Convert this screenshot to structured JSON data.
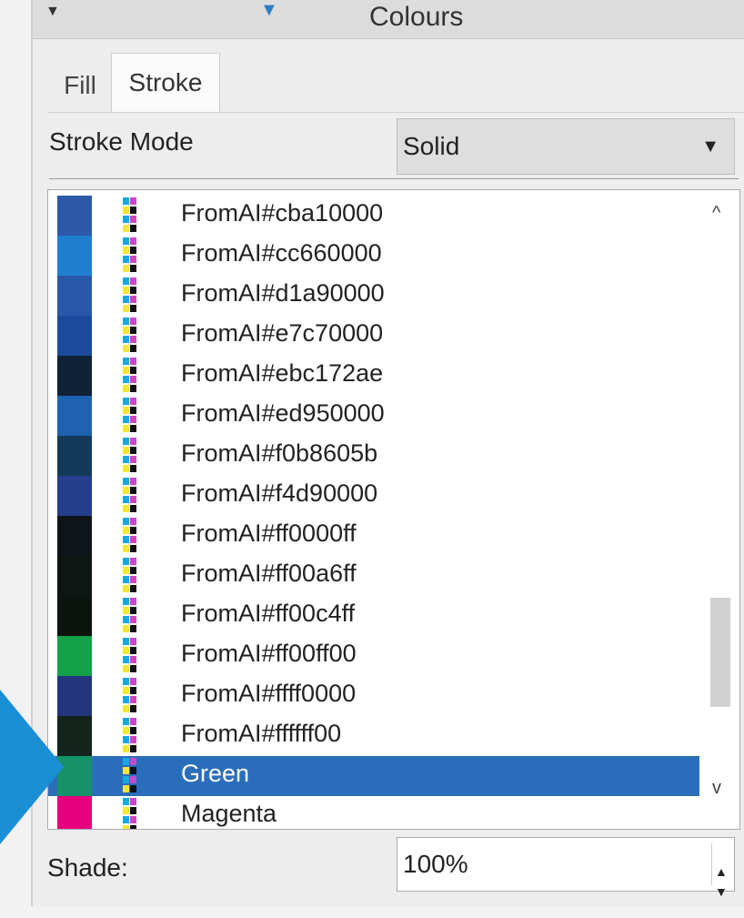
{
  "titlebar": {
    "title": "Colours",
    "left_arrow": "▼",
    "mid_arrow": "▼"
  },
  "tabs": [
    {
      "label": "Fill"
    },
    {
      "label": "Stroke",
      "active": true
    }
  ],
  "stroke_mode": {
    "label": "Stroke Mode",
    "value": "Solid",
    "arrow": "▼"
  },
  "list": {
    "selected_index": 14,
    "items": [
      {
        "name": "FromAI#cba10000",
        "swatch": "#2c5aa8"
      },
      {
        "name": "FromAI#cc660000",
        "swatch": "#1f7ecf"
      },
      {
        "name": "FromAI#d1a90000",
        "swatch": "#2a58a8"
      },
      {
        "name": "FromAI#e7c70000",
        "swatch": "#1c4b9c"
      },
      {
        "name": "FromAI#ebc172ae",
        "swatch": "#0f2236"
      },
      {
        "name": "FromAI#ed950000",
        "swatch": "#1f62b1"
      },
      {
        "name": "FromAI#f0b8605b",
        "swatch": "#133a5a"
      },
      {
        "name": "FromAI#f4d90000",
        "swatch": "#253e8e"
      },
      {
        "name": "FromAI#ff0000ff",
        "swatch": "#0f1418"
      },
      {
        "name": "FromAI#ff00a6ff",
        "swatch": "#0e1512"
      },
      {
        "name": "FromAI#ff00c4ff",
        "swatch": "#0d1410"
      },
      {
        "name": "FromAI#ff00ff00",
        "swatch": "#15a04a"
      },
      {
        "name": "FromAI#ffff0000",
        "swatch": "#23357e"
      },
      {
        "name": "FromAI#ffffff00",
        "swatch": "#12241c"
      },
      {
        "name": "Green",
        "swatch": "#159267"
      },
      {
        "name": "Magenta",
        "swatch": "#e6007e"
      }
    ]
  },
  "scroll": {
    "up": "^",
    "down": "v"
  },
  "shade": {
    "label": "Shade:",
    "value": "100%",
    "up": "▲",
    "down": "▼"
  },
  "colors": {
    "accent": "#2a6ebb",
    "pointer": "#1a8fd6",
    "cyan": "#18a8e0",
    "yellow": "#f2e733",
    "magenta": "#cc44cc",
    "black": "#111111"
  }
}
